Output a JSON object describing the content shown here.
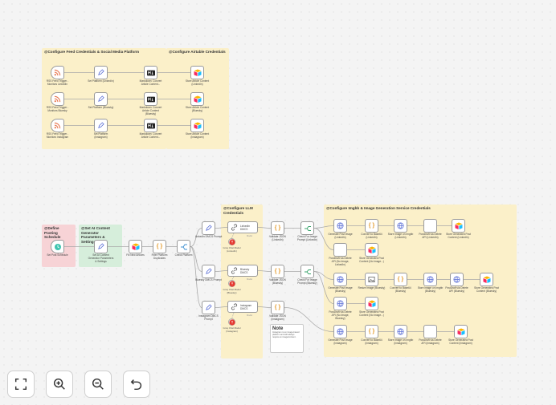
{
  "sticky_notes": [
    {
      "id": "s1",
      "title": "@Configure Feed Credentials & Social Media Platform",
      "color": "#fbf0c9"
    },
    {
      "id": "s2",
      "title": "@Configure Airtable Credentials",
      "color": "#fbf0c9"
    },
    {
      "id": "s3",
      "title": "@Define Posting Schedule",
      "color": "#f7d3d6"
    },
    {
      "id": "s4",
      "title": "@Set AI Content Generator Parameters & Settings",
      "color": "#d6eedb"
    },
    {
      "id": "s5",
      "title": "@Configure LLM Credentials",
      "color": "#fbf0c9"
    },
    {
      "id": "s6",
      "title": "@Configure Imgbb & Image Generation Service Credentials",
      "color": "#fbf0c9"
    }
  ],
  "nodes": {
    "rss1": {
      "label": "RSS Feed Trigger - Monitors LinkedIn",
      "sub": "",
      "icon": "rss-icon"
    },
    "rss2": {
      "label": "RSS Feed Trigger - Monitors Bluesky",
      "sub": "",
      "icon": "rss-icon"
    },
    "rss3": {
      "label": "RSS Feed Trigger - Monitors Instagram",
      "sub": "",
      "icon": "rss-icon"
    },
    "setp1": {
      "label": "Set Platform (LinkedIn)",
      "sub": "",
      "icon": "pen-icon"
    },
    "setp2": {
      "label": "Set Platform (Bluesky)",
      "sub": "",
      "icon": "pen-icon"
    },
    "setp3": {
      "label": "Set Platform (Instagram)",
      "sub": "",
      "icon": "pen-icon"
    },
    "md1": {
      "label": "Markdown: Convert Article Content...",
      "sub": "(LinkedIn)",
      "icon": "markdown-icon"
    },
    "md2": {
      "label": "Markdown: Convert Article Content (Bluesky)",
      "sub": "",
      "icon": "markdown-icon"
    },
    "md3": {
      "label": "Markdown: Convert Article Content...",
      "sub": "",
      "icon": "markdown-icon"
    },
    "at1": {
      "label": "Store Article Content (LinkedIn)",
      "sub": "",
      "icon": "airtable-icon"
    },
    "at2": {
      "label": "Store Article Content (Bluesky)",
      "sub": "",
      "icon": "airtable-icon"
    },
    "at3": {
      "label": "Store Article Content (Instagram)",
      "sub": "",
      "icon": "airtable-icon"
    },
    "sched": {
      "label": "Set Post Schedule",
      "sub": "",
      "icon": "clock-icon"
    },
    "setai": {
      "label": "Set AI Content Generator Parameters & Settings",
      "sub": "",
      "icon": "pen-icon"
    },
    "fetch": {
      "label": "Fill New Articles",
      "sub": "",
      "icon": "airtable-icon"
    },
    "filter": {
      "label": "Filter Platform Duplicates",
      "sub": "",
      "icon": "code-icon"
    },
    "check": {
      "label": "Check Platform",
      "sub": "",
      "icon": "switch-icon"
    },
    "lp1": {
      "label": "LinkedIn DMCS Prompt",
      "sub": "",
      "icon": "pen-icon"
    },
    "lp2": {
      "label": "Bluesky DMCS Prompt",
      "sub": "",
      "icon": "pen-icon"
    },
    "lp3": {
      "label": "Instagram DMCS Prompt",
      "sub": "",
      "icon": "pen-icon"
    },
    "ag1": {
      "label": "LinkedIn DMCS",
      "sub": "",
      "icon": "link-icon"
    },
    "ag2": {
      "label": "Bluesky DMCS",
      "sub": "",
      "icon": "link-icon"
    },
    "ag3": {
      "label": "Instagram DMCS",
      "sub": "",
      "icon": "link-icon"
    },
    "cm1": {
      "label": "Groq Chat Model (LinkedIn)",
      "sub": "",
      "icon": "groq-icon"
    },
    "cm2": {
      "label": "Groq Chat Model (Bluesky)",
      "sub": "",
      "icon": "groq-icon"
    },
    "cm3": {
      "label": "Groq Chat Model (Instagram)",
      "sub": "",
      "icon": "groq-icon"
    },
    "vj1": {
      "label": "Validate JSON (LinkedIn)",
      "sub": "",
      "icon": "code-icon"
    },
    "vj2": {
      "label": "Validate JSON (Bluesky)",
      "sub": "",
      "icon": "code-icon"
    },
    "vj3": {
      "label": "Validate JSON (Instagram)",
      "sub": "",
      "icon": "code-icon"
    },
    "ci1": {
      "label": "Check For Image Prompt (LinkedIn)",
      "sub": "",
      "icon": "if-icon"
    },
    "ci2": {
      "label": "Check For Image Prompt (Bluesky)",
      "sub": "",
      "icon": "if-icon"
    },
    "g1": {
      "label": "Generate Post Image (LinkedIn)",
      "sub": "",
      "icon": "globe-icon"
    },
    "g2": {
      "label": "Generate Post Image (Bluesky)",
      "sub": "",
      "icon": "globe-icon"
    },
    "g3": {
      "label": "Generate Post Image (Instagram)",
      "sub": "",
      "icon": "globe-icon"
    },
    "cb1": {
      "label": "Convert to Base64 (LinkedIn)",
      "sub": "",
      "icon": "code-icon"
    },
    "cb2": {
      "label": "Resize Image (Bluesky)",
      "sub": "",
      "icon": "image-icon"
    },
    "cb3": {
      "label": "Convert to Base64 (Instagram)",
      "sub": "",
      "icon": "code-icon"
    },
    "ib1": {
      "label": "Store Image on Imgbb (LinkedIn)",
      "sub": "",
      "icon": "globe-icon"
    },
    "ib2": {
      "label": "Convert to Base64 (Bluesky)",
      "sub": "",
      "icon": "code-icon"
    },
    "ib3": {
      "label": "Store Image on Imgbb (Instagram)",
      "sub": "",
      "icon": "globe-icon"
    },
    "pd1": {
      "label": "PostDraft via Delete API (LinkedIn)",
      "sub": "",
      "icon": "blank-icon"
    },
    "pd2": {
      "label": "Store Image on Imgbb (Bluesky)",
      "sub": "",
      "icon": "globe-icon"
    },
    "pd3": {
      "label": "PostDraft via Delete API (Instagram)",
      "sub": "",
      "icon": "blank-icon"
    },
    "sg1": {
      "label": "Store Generated Post Content (LinkedIn)",
      "sub": "",
      "icon": "airtable-icon"
    },
    "sg2": {
      "label": "PostDraft via Delete API (Bluesky)",
      "sub": "",
      "icon": "globe-icon"
    },
    "sg3": {
      "label": "Store Generated Post Content (Instagram)",
      "sub": "",
      "icon": "airtable-icon"
    },
    "sg2b": {
      "label": "Store Generated Post Content (Bluesky)",
      "sub": "",
      "icon": "airtable-icon"
    },
    "pdn1": {
      "label": "PostDraft via Delete API (No Image, LinkedIn)",
      "sub": "",
      "icon": "blank-icon"
    },
    "sgn1": {
      "label": "Store Generated Post Content (No Image...)",
      "sub": "",
      "icon": "airtable-icon"
    },
    "pdn2": {
      "label": "PostDraft via Delete API (No Image, Bluesky)",
      "sub": "",
      "icon": "globe-icon"
    },
    "sgn2": {
      "label": "Store Generated Post Content (No Image...)",
      "sub": "",
      "icon": "airtable-icon"
    }
  },
  "edge_labels": [
    "Model",
    "Model",
    "Model"
  ],
  "note": {
    "title": "Note",
    "body": "Instagram is an image-based platform and will always require an image/content."
  },
  "controls": [
    {
      "name": "fit-view-button",
      "icon": "fit-view-icon"
    },
    {
      "name": "zoom-in-button",
      "icon": "zoom-in-icon"
    },
    {
      "name": "zoom-out-button",
      "icon": "zoom-out-icon"
    },
    {
      "name": "undo-button",
      "icon": "undo-icon"
    }
  ],
  "colors": {
    "sticky_yellow": "#fbf0c9",
    "sticky_pink": "#f7d3d6",
    "sticky_green": "#d6eedb",
    "wire": "#a9a9a9",
    "groq": "#e5382f"
  }
}
